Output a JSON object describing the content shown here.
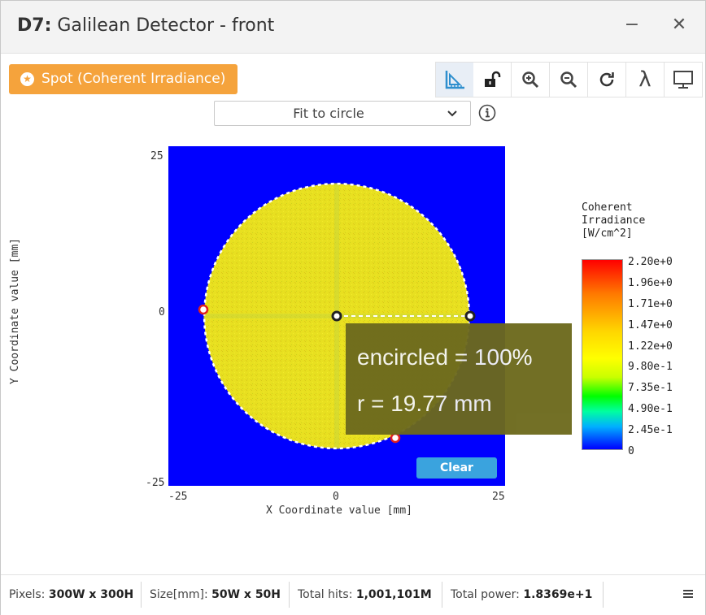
{
  "window": {
    "title_prefix": "D7:",
    "title_rest": " Galilean Detector - front",
    "minimize_glyph": "−",
    "close_glyph": "✕"
  },
  "spot_button": {
    "label": "Spot (Coherent Irradiance)",
    "icon": "star-circle-icon"
  },
  "toolbar": {
    "buttons": [
      {
        "name": "ruler-icon",
        "active": true
      },
      {
        "name": "unlock-icon",
        "active": false
      },
      {
        "name": "zoom-in-icon",
        "active": false
      },
      {
        "name": "zoom-out-icon",
        "active": false
      },
      {
        "name": "refresh-icon",
        "active": false
      },
      {
        "name": "lambda-icon",
        "active": false
      },
      {
        "name": "monitor-icon",
        "active": false
      }
    ],
    "lambda_glyph": "λ"
  },
  "fit_select": {
    "value": "Fit to circle",
    "icon": "info-icon"
  },
  "plot": {
    "xlabel": "X Coordinate value [mm]",
    "ylabel": "Y Coordinate value [mm]",
    "x_ticks": [
      "-25",
      "0",
      "25"
    ],
    "y_ticks": [
      "25",
      "0",
      "-25"
    ],
    "xlim": [
      -25,
      25
    ],
    "ylim": [
      -25,
      25
    ],
    "circle_radius_mm": 19.77,
    "background_color": "#0000ff",
    "spot_color": "#e6e01a"
  },
  "tooltip": {
    "line1": "encircled = 100%",
    "line2": "r = 19.77 mm"
  },
  "clear_button": {
    "label": "Clear"
  },
  "colorbar": {
    "title": "Coherent\nIrradiance\n[W/cm^2]",
    "ticks": [
      "2.20e+0",
      "1.96e+0",
      "1.71e+0",
      "1.47e+0",
      "1.22e+0",
      "9.80e-1",
      "7.35e-1",
      "4.90e-1",
      "2.45e-1",
      "0"
    ]
  },
  "status": {
    "pixels_label": "Pixels:",
    "pixels_value": "300W x 300H",
    "size_label": "Size[mm]:",
    "size_value": "50W x 50H",
    "hits_label": "Total hits:",
    "hits_value": "1,001,101M",
    "power_label": "Total power:",
    "power_value": "1.8369e+1"
  }
}
